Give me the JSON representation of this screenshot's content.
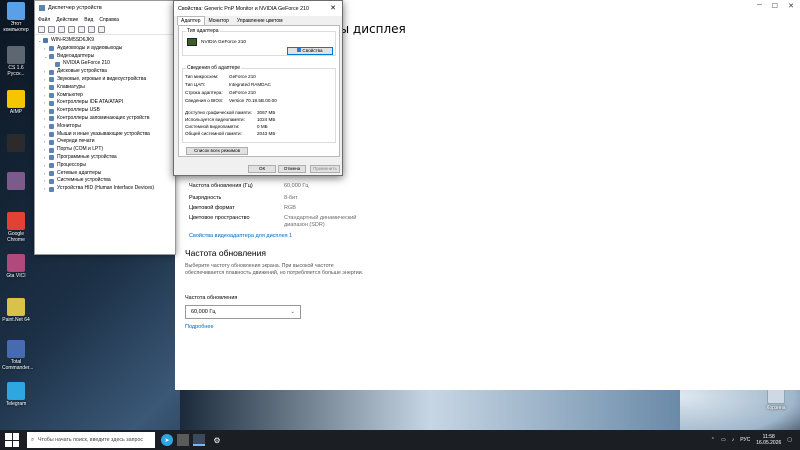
{
  "desktop": {
    "icons": [
      {
        "label": "Этот компьютер",
        "color": "#5aa0e6"
      },
      {
        "label": "CS 1.6 Русск...",
        "color": "#5d6772"
      },
      {
        "label": "AIMP",
        "color": "#f5c600"
      },
      {
        "label": "",
        "color": "#2b2b2b"
      },
      {
        "label": "",
        "color": "#7b5a8c"
      },
      {
        "label": "Google Chrome",
        "color": "#e34133"
      },
      {
        "label": "Gta VICI",
        "color": "#b04a7c"
      },
      {
        "label": "Paint.Net 64",
        "color": "#d8c24a"
      },
      {
        "label": "Total Commander...",
        "color": "#486bb0"
      },
      {
        "label": "Telegram",
        "color": "#2ea6df"
      }
    ],
    "recycle_bin": "Корзина"
  },
  "device_manager": {
    "title": "Диспетчер устройств",
    "menu": [
      "Файл",
      "Действие",
      "Вид",
      "Справка"
    ],
    "tree": [
      {
        "label": "WIN-R3M5SD6JK9",
        "level": 0,
        "exp": "⌄"
      },
      {
        "label": "Аудиовходы и аудиовыходы",
        "level": 1,
        "exp": "›"
      },
      {
        "label": "Видеоадаптеры",
        "level": 1,
        "exp": "⌄"
      },
      {
        "label": "NVIDIA GeForce 210",
        "level": 2,
        "exp": ""
      },
      {
        "label": "Дисковые устройства",
        "level": 1,
        "exp": "›"
      },
      {
        "label": "Звуковые, игровые и видеоустройства",
        "level": 1,
        "exp": "›"
      },
      {
        "label": "Клавиатуры",
        "level": 1,
        "exp": "›"
      },
      {
        "label": "Компьютер",
        "level": 1,
        "exp": "›"
      },
      {
        "label": "Контроллеры IDE ATA/ATAPI",
        "level": 1,
        "exp": "›"
      },
      {
        "label": "Контроллеры USB",
        "level": 1,
        "exp": "›"
      },
      {
        "label": "Контроллеры запоминающих устройств",
        "level": 1,
        "exp": "›"
      },
      {
        "label": "Мониторы",
        "level": 1,
        "exp": "›"
      },
      {
        "label": "Мыши и иные указывающие устройства",
        "level": 1,
        "exp": "›"
      },
      {
        "label": "Очереди печати",
        "level": 1,
        "exp": "›"
      },
      {
        "label": "Порты (COM и LPT)",
        "level": 1,
        "exp": "›"
      },
      {
        "label": "Программные устройства",
        "level": 1,
        "exp": "›"
      },
      {
        "label": "Процессоры",
        "level": 1,
        "exp": "›"
      },
      {
        "label": "Сетевые адаптеры",
        "level": 1,
        "exp": "›"
      },
      {
        "label": "Системные устройства",
        "level": 1,
        "exp": "›"
      },
      {
        "label": "Устройства HID (Human Interface Devices)",
        "level": 1,
        "exp": "›"
      }
    ]
  },
  "properties": {
    "title": "Свойства: Generic PnP Monitor и NVIDIA GeForce 210",
    "tabs": [
      "Адаптер",
      "Монитор",
      "Управление цветом"
    ],
    "adapter_type_label": "Тип адаптера",
    "adapter_name": "NVIDIA GeForce 210",
    "properties_button": "Свойства",
    "info_group_label": "Сведения об адаптере",
    "info": [
      {
        "k": "Тип микросхем:",
        "v": "GeForce 210"
      },
      {
        "k": "Тип ЦАП:",
        "v": "Integrated RAMDAC"
      },
      {
        "k": "Строка адаптера:",
        "v": "GeForce 210"
      },
      {
        "k": "Сведения о BIOS:",
        "v": "Version 70.18.5B.00.00"
      }
    ],
    "memory": [
      {
        "k": "Доступно графической памяти:",
        "v": "3067 МБ"
      },
      {
        "k": "Используется видеопамяти:",
        "v": "1024 МБ"
      },
      {
        "k": "Системной видеопамяти:",
        "v": "0 МБ"
      },
      {
        "k": "Общей системной памяти:",
        "v": "2043 МБ"
      }
    ],
    "list_modes_button": "Список всех режимов",
    "ok": "ОК",
    "cancel": "Отмена",
    "apply": "Применить"
  },
  "settings": {
    "title_fragment": "ры дисплея",
    "rows": [
      {
        "k": "Активное разрешение сигнала",
        "v": "1600 × 900"
      },
      {
        "k": "Частота обновления (Гц)",
        "v": "60,000 Гц"
      },
      {
        "k": "Разрядность",
        "v": "8-бит"
      },
      {
        "k": "Цветовой формат",
        "v": "RGB"
      },
      {
        "k": "Цветовое пространство",
        "v": "Стандартный динамический диапазон (SDR)"
      }
    ],
    "adapter_link": "Свойства видеоадаптера для дисплея 1",
    "refresh_heading": "Частота обновления",
    "refresh_desc": "Выберите частоту обновления экрана. При высокой частоте обеспечивается плавность движений, но потребляется больше энергии.",
    "refresh_label": "Частота обновления",
    "refresh_value": "60,000 Гц",
    "more_link": "Подробнее"
  },
  "taskbar": {
    "search_placeholder": "Чтобы начать поиск, введите здесь запрос",
    "lang": "РУС",
    "time": "11:58",
    "date": "16.05.2026"
  }
}
